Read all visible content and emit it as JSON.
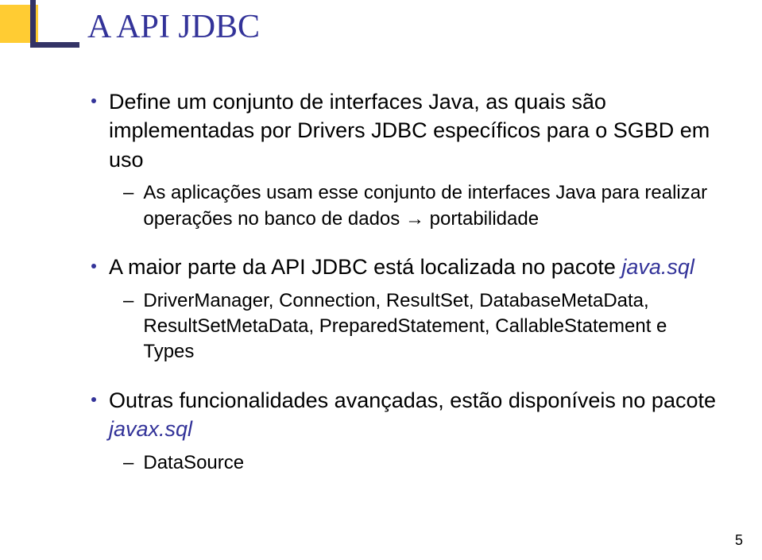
{
  "title": "A API JDBC",
  "bullets": {
    "b1": "Define um conjunto de interfaces Java, as quais são implementadas por Drivers JDBC específicos para o SGBD em uso",
    "b1a": "As aplicações usam esse conjunto de interfaces Java para realizar operações no banco de dados → portabilidade",
    "b2_pre": "A maior parte da API JDBC está localizada no pacote ",
    "b2_em": "java.sql",
    "b2a": "DriverManager, Connection, ResultSet, DatabaseMetaData, ResultSetMetaData, PreparedStatement, CallableStatement e Types",
    "b3_pre": "Outras funcionalidades avançadas, estão disponíveis no pacote ",
    "b3_em": "javax.sql",
    "b3a": "DataSource"
  },
  "pageNumber": "5"
}
